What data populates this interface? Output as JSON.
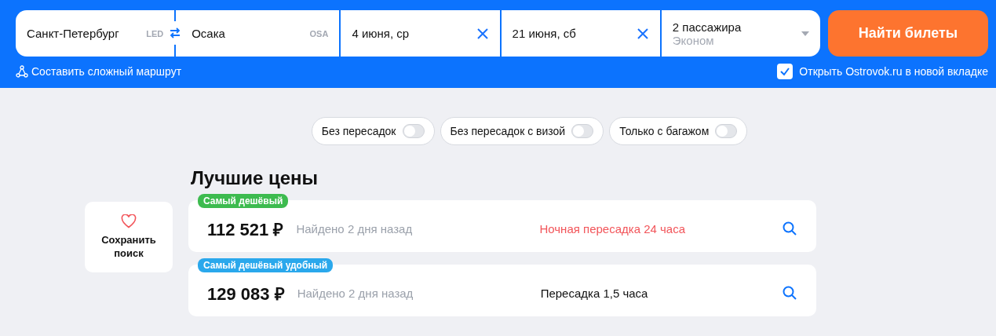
{
  "search_form": {
    "origin": {
      "city": "Санкт-Петербург",
      "code": "LED"
    },
    "destination": {
      "city": "Осака",
      "code": "OSA"
    },
    "dates": [
      {
        "value": "4 июня, ср"
      },
      {
        "value": "21 июня, сб"
      }
    ],
    "passengers": {
      "count": "2 пассажира",
      "class": "Эконом"
    },
    "submit": "Найти билеты",
    "complex_route_link": "Составить сложный маршрут",
    "new_tab_option": {
      "label": "Открыть Ostrovok.ru в новой вкладке",
      "checked": true
    }
  },
  "filters": [
    {
      "label": "Без пересадок",
      "on": false
    },
    {
      "label": "Без пересадок с визой",
      "on": false
    },
    {
      "label": "Только с багажом",
      "on": false
    }
  ],
  "save_search": {
    "label": "Сохранить поиск"
  },
  "best_prices": {
    "title": "Лучшие цены",
    "offers": [
      {
        "badge": "Самый дешёвый",
        "color": "#3dbb4f",
        "price": "112 521 ₽",
        "found": "Найдено 2 дня назад",
        "transfer": "Ночная пересадка 24 часа",
        "warning": true
      },
      {
        "badge": "Самый дешёвый удобный",
        "color": "#2aa8ec",
        "price": "129 083 ₽",
        "found": "Найдено 2 дня назад",
        "transfer": "Пересадка 1,5 часа",
        "warning": false
      }
    ]
  }
}
